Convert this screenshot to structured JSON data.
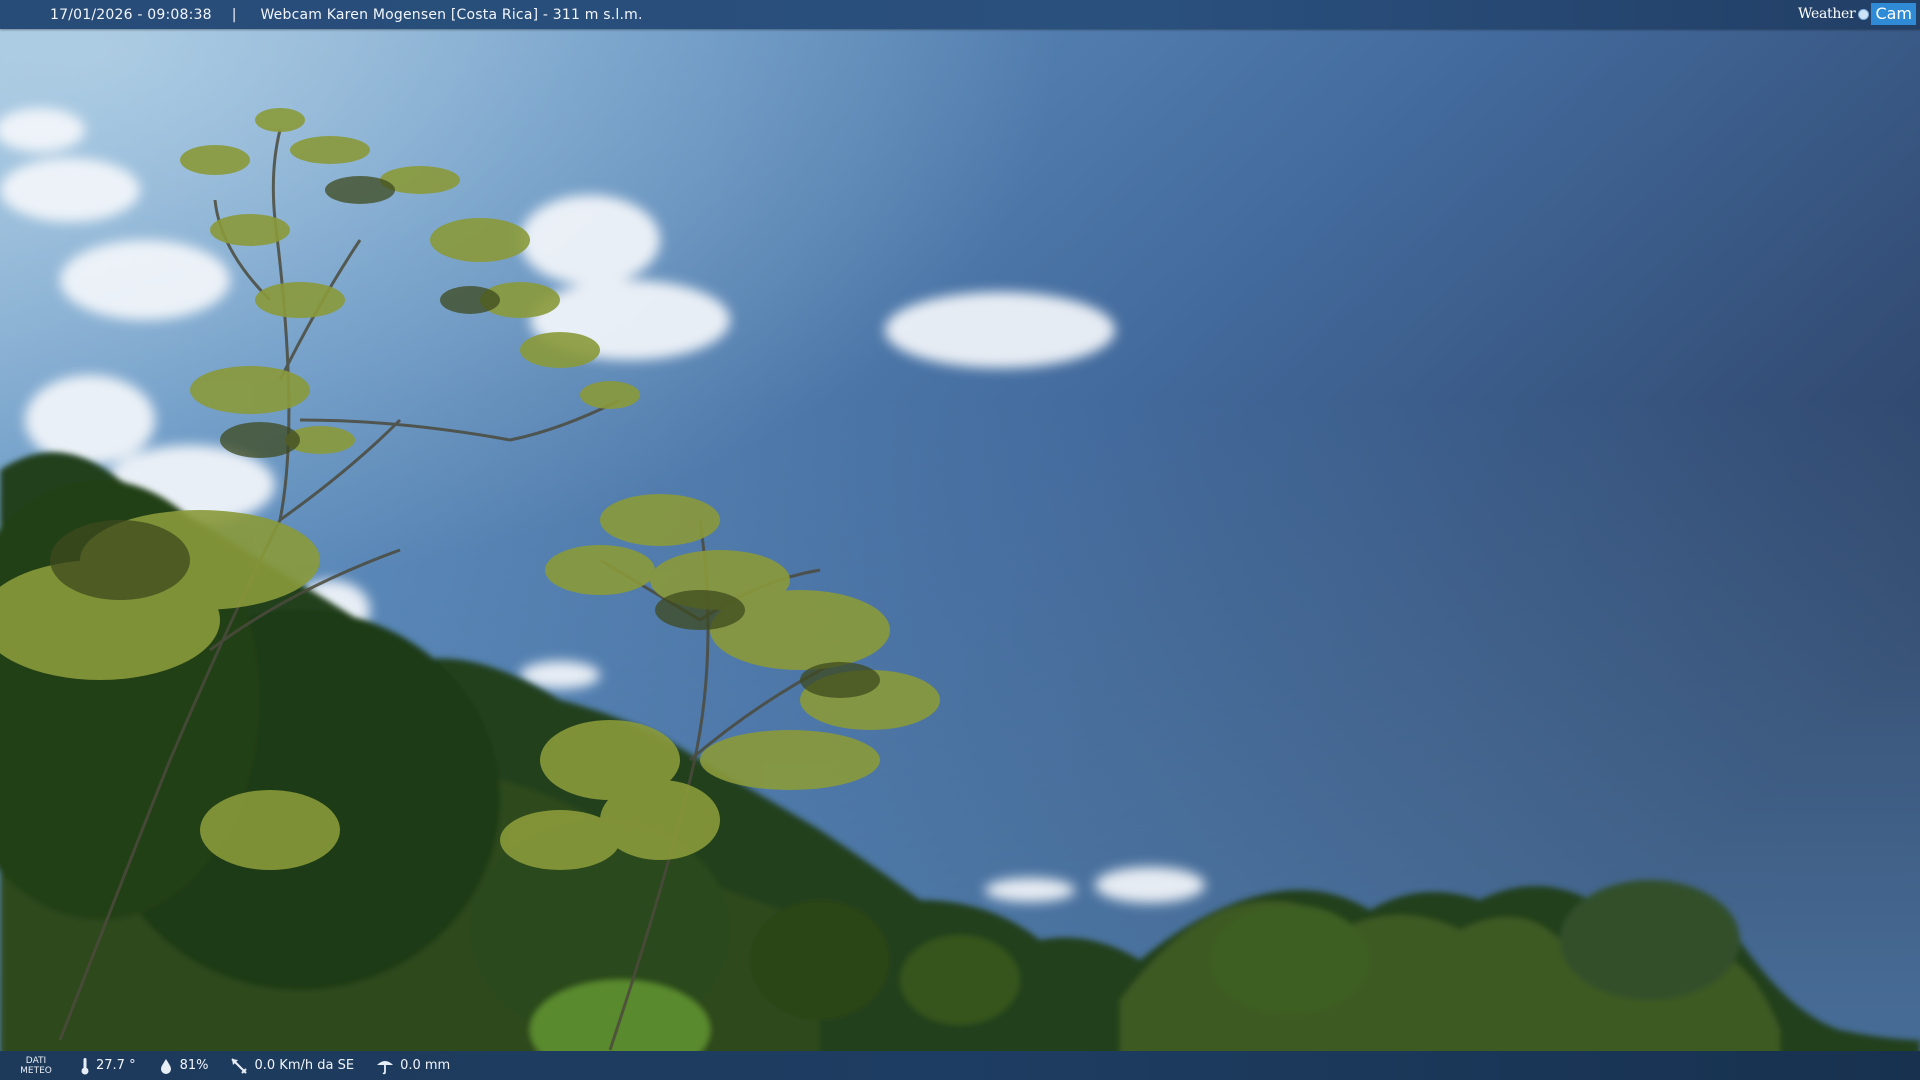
{
  "header": {
    "datetime": "17/01/2026 - 09:08:38",
    "separator": "|",
    "title": "Webcam Karen Mogensen [Costa Rica]  - 311 m s.l.m."
  },
  "logo": {
    "weather_text": "Weather",
    "cam_text": "Cam"
  },
  "footer": {
    "label": "DATI METEO",
    "temperature": "27.7 °",
    "humidity": "81%",
    "wind": "0.0 Km/h da SE",
    "rain": "0.0 mm"
  }
}
